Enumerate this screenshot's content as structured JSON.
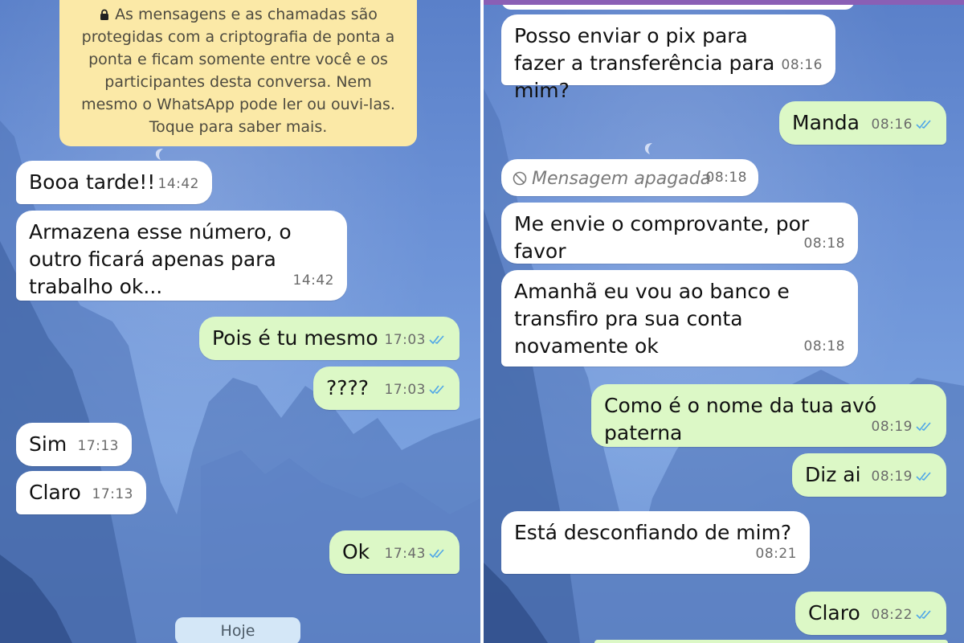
{
  "left": {
    "banner": "As mensagens e as chamadas são protegidas com a criptografia de ponta a ponta e ficam somente entre você e os participantes desta conversa. Nem mesmo o WhatsApp pode ler ou ouvi-las. Toque para saber mais.",
    "day_label": "Hoje",
    "messages": [
      {
        "dir": "in",
        "text": "Booa tarde!!",
        "time": "14:42"
      },
      {
        "dir": "in",
        "text": "Armazena esse número, o outro ficará apenas para trabalho ok...",
        "time": "14:42"
      },
      {
        "dir": "out",
        "text": "Pois é tu mesmo",
        "time": "17:03"
      },
      {
        "dir": "out",
        "text": "????",
        "time": "17:03"
      },
      {
        "dir": "in",
        "text": "Sim",
        "time": "17:13"
      },
      {
        "dir": "in",
        "text": "Claro",
        "time": "17:13"
      },
      {
        "dir": "out",
        "text": "Ok",
        "time": "17:43"
      }
    ]
  },
  "right": {
    "messages": [
      {
        "dir": "in",
        "text": "Posso enviar o pix para fazer a transferência para mim?",
        "time": "08:16"
      },
      {
        "dir": "out",
        "text": "Manda",
        "time": "08:16"
      },
      {
        "dir": "in",
        "text": "Mensagem apagada",
        "time": "08:18",
        "deleted": true
      },
      {
        "dir": "in",
        "text": "Me envie o comprovante, por favor",
        "time": "08:18"
      },
      {
        "dir": "in",
        "text": "Amanhã eu vou ao banco e transfiro pra sua conta novamente ok",
        "time": "08:18"
      },
      {
        "dir": "out",
        "text": "Como é o nome da tua avó paterna",
        "time": "08:19"
      },
      {
        "dir": "out",
        "text": "Diz ai",
        "time": "08:19"
      },
      {
        "dir": "in",
        "text": "Está desconfiando de mim?",
        "time": "08:21"
      },
      {
        "dir": "out",
        "text": "Claro",
        "time": "08:22"
      }
    ]
  },
  "icons": {
    "lock": "lock-icon",
    "read_receipt": "double-check-icon",
    "deleted": "ban-icon"
  },
  "colors": {
    "incoming_bubble": "#ffffff",
    "outgoing_bubble": "#dcf8c6",
    "banner": "#fbe9a7",
    "read_ticks": "#4fa6e8"
  }
}
